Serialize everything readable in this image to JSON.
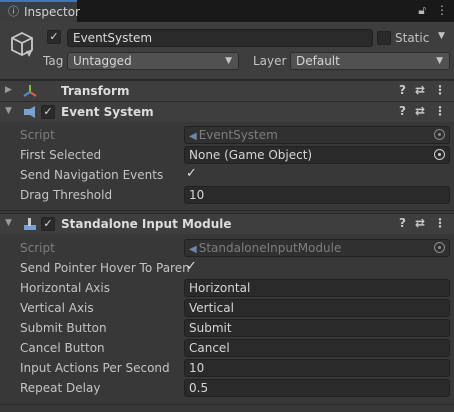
{
  "tab": {
    "label": "Inspector",
    "lock_icon": "lock-icon",
    "menu_icon": "kebab-icon"
  },
  "gameobject": {
    "active": true,
    "name": "EventSystem",
    "static_label": "Static",
    "tag_label": "Tag",
    "tag_value": "Untagged",
    "layer_label": "Layer",
    "layer_value": "Default"
  },
  "components": {
    "transform": {
      "title": "Transform"
    },
    "event_system": {
      "title": "Event System",
      "enabled": true,
      "script_label": "Script",
      "script_value": "EventSystem",
      "first_selected_label": "First Selected",
      "first_selected_value": "None (Game Object)",
      "send_nav_label": "Send Navigation Events",
      "send_nav_value": true,
      "drag_threshold_label": "Drag Threshold",
      "drag_threshold_value": "10"
    },
    "standalone": {
      "title": "Standalone Input Module",
      "enabled": true,
      "script_label": "Script",
      "script_value": "StandaloneInputModule",
      "hover_label": "Send Pointer Hover To Paren",
      "hover_value": true,
      "horizontal_label": "Horizontal Axis",
      "horizontal_value": "Horizontal",
      "vertical_label": "Vertical Axis",
      "vertical_value": "Vertical",
      "submit_label": "Submit Button",
      "submit_value": "Submit",
      "cancel_label": "Cancel Button",
      "cancel_value": "Cancel",
      "iaps_label": "Input Actions Per Second",
      "iaps_value": "10",
      "repeat_label": "Repeat Delay",
      "repeat_value": "0.5"
    }
  },
  "colors": {
    "background": "#383838",
    "accent": "#3a79bb"
  }
}
